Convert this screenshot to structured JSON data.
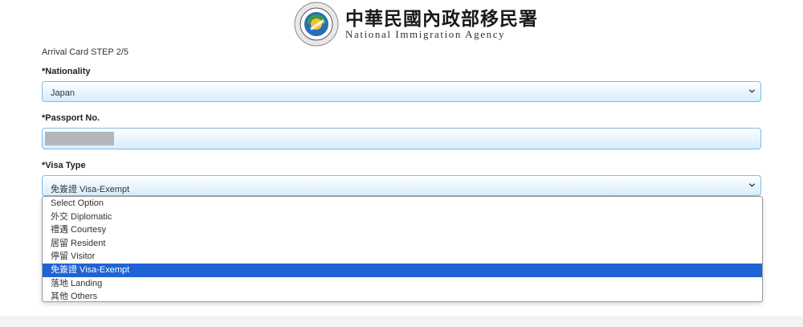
{
  "header": {
    "agency_name_zh": "中華民國內政部移民署",
    "agency_name_en": "National Immigration Agency",
    "logo_icon": "nia-emblem-icon"
  },
  "form": {
    "step_text": "Arrival Card STEP 2/5",
    "nationality": {
      "label": "*Nationality",
      "value": "Japan"
    },
    "passport": {
      "label": "*Passport No.",
      "value": ""
    },
    "visa_type": {
      "label": "*Visa Type",
      "value": "免簽證 Visa-Exempt",
      "options": [
        "Select Option",
        "外交 Diplomatic",
        "禮遇 Courtesy",
        "居留 Resident",
        "停留 Visitor",
        "免簽證 Visa-Exempt",
        "落地 Landing",
        "其他 Others"
      ],
      "selected_index": 5
    }
  },
  "colors": {
    "field_border": "#7fbcea",
    "highlight": "#1f63d4"
  }
}
